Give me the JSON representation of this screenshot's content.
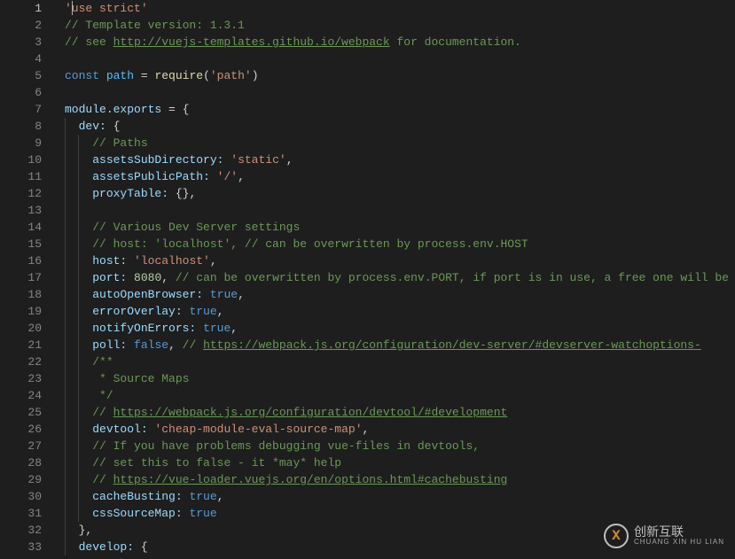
{
  "lines": [
    {
      "n": 1,
      "active": true,
      "segs": [
        {
          "cls": "t-str",
          "t": "'use strict'"
        }
      ],
      "cursor": true
    },
    {
      "n": 2,
      "segs": [
        {
          "cls": "t-comment",
          "t": "// Template version: 1.3.1"
        }
      ]
    },
    {
      "n": 3,
      "segs": [
        {
          "cls": "t-comment",
          "t": "// see "
        },
        {
          "cls": "t-link",
          "t": "http://vuejs-templates.github.io/webpack"
        },
        {
          "cls": "t-comment",
          "t": " for documentation."
        }
      ]
    },
    {
      "n": 4,
      "segs": []
    },
    {
      "n": 5,
      "segs": [
        {
          "cls": "t-key",
          "t": "const"
        },
        {
          "cls": "",
          "t": " "
        },
        {
          "cls": "t-const",
          "t": "path"
        },
        {
          "cls": "",
          "t": " = "
        },
        {
          "cls": "t-func",
          "t": "require"
        },
        {
          "cls": "t-punc",
          "t": "("
        },
        {
          "cls": "t-str",
          "t": "'path'"
        },
        {
          "cls": "t-punc",
          "t": ")"
        }
      ],
      "marker": true
    },
    {
      "n": 6,
      "segs": []
    },
    {
      "n": 7,
      "segs": [
        {
          "cls": "t-var",
          "t": "module"
        },
        {
          "cls": "t-punc",
          "t": "."
        },
        {
          "cls": "t-var",
          "t": "exports"
        },
        {
          "cls": "",
          "t": " = {"
        }
      ],
      "marker": true
    },
    {
      "n": 8,
      "indent": 1,
      "segs": [
        {
          "cls": "t-var",
          "t": "dev:"
        },
        {
          "cls": "",
          "t": " {"
        }
      ]
    },
    {
      "n": 9,
      "indent": 2,
      "segs": [
        {
          "cls": "t-comment",
          "t": "// Paths"
        }
      ]
    },
    {
      "n": 10,
      "indent": 2,
      "segs": [
        {
          "cls": "t-var",
          "t": "assetsSubDirectory:"
        },
        {
          "cls": "",
          "t": " "
        },
        {
          "cls": "t-str",
          "t": "'static'"
        },
        {
          "cls": "t-punc",
          "t": ","
        }
      ]
    },
    {
      "n": 11,
      "indent": 2,
      "segs": [
        {
          "cls": "t-var",
          "t": "assetsPublicPath:"
        },
        {
          "cls": "",
          "t": " "
        },
        {
          "cls": "t-str",
          "t": "'/'"
        },
        {
          "cls": "t-punc",
          "t": ","
        }
      ]
    },
    {
      "n": 12,
      "indent": 2,
      "segs": [
        {
          "cls": "t-var",
          "t": "proxyTable:"
        },
        {
          "cls": "",
          "t": " {},"
        }
      ]
    },
    {
      "n": 13,
      "indent": 2,
      "segs": []
    },
    {
      "n": 14,
      "indent": 2,
      "segs": [
        {
          "cls": "t-comment",
          "t": "// Various Dev Server settings"
        }
      ]
    },
    {
      "n": 15,
      "indent": 2,
      "segs": [
        {
          "cls": "t-comment",
          "t": "// host: 'localhost', // can be overwritten by process.env.HOST"
        }
      ]
    },
    {
      "n": 16,
      "indent": 2,
      "segs": [
        {
          "cls": "t-var",
          "t": "host:"
        },
        {
          "cls": "",
          "t": " "
        },
        {
          "cls": "t-str",
          "t": "'localhost'"
        },
        {
          "cls": "t-punc",
          "t": ","
        }
      ]
    },
    {
      "n": 17,
      "indent": 2,
      "segs": [
        {
          "cls": "t-var",
          "t": "port:"
        },
        {
          "cls": "",
          "t": " "
        },
        {
          "cls": "t-num",
          "t": "8080"
        },
        {
          "cls": "t-punc",
          "t": ", "
        },
        {
          "cls": "t-comment",
          "t": "// can be overwritten by process.env.PORT, if port is in use, a free one will be d"
        }
      ]
    },
    {
      "n": 18,
      "indent": 2,
      "segs": [
        {
          "cls": "t-var",
          "t": "autoOpenBrowser:"
        },
        {
          "cls": "",
          "t": " "
        },
        {
          "cls": "t-bool",
          "t": "true"
        },
        {
          "cls": "t-punc",
          "t": ","
        }
      ]
    },
    {
      "n": 19,
      "indent": 2,
      "segs": [
        {
          "cls": "t-var",
          "t": "errorOverlay:"
        },
        {
          "cls": "",
          "t": " "
        },
        {
          "cls": "t-bool",
          "t": "true"
        },
        {
          "cls": "t-punc",
          "t": ","
        }
      ]
    },
    {
      "n": 20,
      "indent": 2,
      "segs": [
        {
          "cls": "t-var",
          "t": "notifyOnErrors:"
        },
        {
          "cls": "",
          "t": " "
        },
        {
          "cls": "t-bool",
          "t": "true"
        },
        {
          "cls": "t-punc",
          "t": ","
        }
      ]
    },
    {
      "n": 21,
      "indent": 2,
      "segs": [
        {
          "cls": "t-var",
          "t": "poll:"
        },
        {
          "cls": "",
          "t": " "
        },
        {
          "cls": "t-bool",
          "t": "false"
        },
        {
          "cls": "t-punc",
          "t": ", "
        },
        {
          "cls": "t-comment",
          "t": "// "
        },
        {
          "cls": "t-link",
          "t": "https://webpack.js.org/configuration/dev-server/#devserver-watchoptions-"
        }
      ]
    },
    {
      "n": 22,
      "indent": 2,
      "segs": [
        {
          "cls": "t-comment",
          "t": "/**"
        }
      ]
    },
    {
      "n": 23,
      "indent": 2,
      "segs": [
        {
          "cls": "t-comment",
          "t": " * Source Maps"
        }
      ]
    },
    {
      "n": 24,
      "indent": 2,
      "segs": [
        {
          "cls": "t-comment",
          "t": " */"
        }
      ]
    },
    {
      "n": 25,
      "indent": 2,
      "segs": [
        {
          "cls": "t-comment",
          "t": "// "
        },
        {
          "cls": "t-link",
          "t": "https://webpack.js.org/configuration/devtool/#development"
        }
      ]
    },
    {
      "n": 26,
      "indent": 2,
      "segs": [
        {
          "cls": "t-var",
          "t": "devtool:"
        },
        {
          "cls": "",
          "t": " "
        },
        {
          "cls": "t-str",
          "t": "'cheap-module-eval-source-map'"
        },
        {
          "cls": "t-punc",
          "t": ","
        }
      ]
    },
    {
      "n": 27,
      "indent": 2,
      "segs": [
        {
          "cls": "t-comment",
          "t": "// If you have problems debugging vue-files in devtools,"
        }
      ]
    },
    {
      "n": 28,
      "indent": 2,
      "segs": [
        {
          "cls": "t-comment",
          "t": "// set this to false - it *may* help"
        }
      ]
    },
    {
      "n": 29,
      "indent": 2,
      "segs": [
        {
          "cls": "t-comment",
          "t": "// "
        },
        {
          "cls": "t-link",
          "t": "https://vue-loader.vuejs.org/en/options.html#cachebusting"
        }
      ]
    },
    {
      "n": 30,
      "indent": 2,
      "segs": [
        {
          "cls": "t-var",
          "t": "cacheBusting:"
        },
        {
          "cls": "",
          "t": " "
        },
        {
          "cls": "t-bool",
          "t": "true"
        },
        {
          "cls": "t-punc",
          "t": ","
        }
      ]
    },
    {
      "n": 31,
      "indent": 2,
      "segs": [
        {
          "cls": "t-var",
          "t": "cssSourceMap:"
        },
        {
          "cls": "",
          "t": " "
        },
        {
          "cls": "t-bool",
          "t": "true"
        }
      ]
    },
    {
      "n": 32,
      "indent": 1,
      "segs": [
        {
          "cls": "t-punc",
          "t": "},"
        }
      ]
    },
    {
      "n": 33,
      "indent": 1,
      "segs": [
        {
          "cls": "t-var",
          "t": "develop:"
        },
        {
          "cls": "",
          "t": " {"
        }
      ]
    }
  ],
  "watermark": {
    "main": "创新互联",
    "sub": "CHUANG XIN HU LIAN",
    "icon": "X"
  }
}
